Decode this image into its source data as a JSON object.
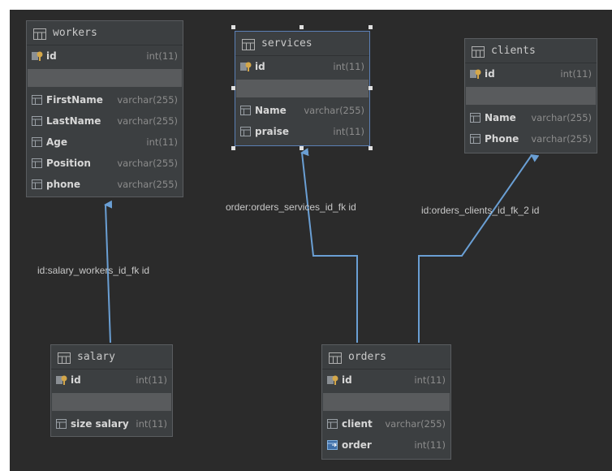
{
  "tables": {
    "workers": {
      "name": "workers",
      "pk": {
        "name": "id",
        "type": "int(11)"
      },
      "columns": [
        {
          "name": "FirstName",
          "type": "varchar(255)"
        },
        {
          "name": "LastName",
          "type": "varchar(255)"
        },
        {
          "name": "Age",
          "type": "int(11)"
        },
        {
          "name": "Position",
          "type": "varchar(255)"
        },
        {
          "name": "phone",
          "type": "varchar(255)"
        }
      ]
    },
    "services": {
      "name": "services",
      "pk": {
        "name": "id",
        "type": "int(11)"
      },
      "columns": [
        {
          "name": "Name",
          "type": "varchar(255)"
        },
        {
          "name": "praise",
          "type": "int(11)"
        }
      ]
    },
    "clients": {
      "name": "clients",
      "pk": {
        "name": "id",
        "type": "int(11)"
      },
      "columns": [
        {
          "name": "Name",
          "type": "varchar(255)"
        },
        {
          "name": "Phone",
          "type": "varchar(255)"
        }
      ]
    },
    "salary": {
      "name": "salary",
      "pk": {
        "name": "id",
        "type": "int(11)"
      },
      "columns": [
        {
          "name": "size salary",
          "type": "int(11)"
        }
      ]
    },
    "orders": {
      "name": "orders",
      "pk": {
        "name": "id",
        "type": "int(11)"
      },
      "columns": [
        {
          "name": "client",
          "type": "varchar(255)"
        },
        {
          "name": "order",
          "type": "int(11)"
        }
      ]
    }
  },
  "relations": {
    "salary_workers": "id:salary_workers_id_fk id",
    "orders_services": "order:orders_services_id_fk id",
    "orders_clients": "id:orders_clients_id_fk_2 id"
  },
  "colors": {
    "canvas": "#2b2b2b",
    "table_bg": "#3c3f41",
    "link": "#6a9fd4",
    "key_icon": "#d4a74a",
    "column_icon": "#9aa0a6"
  },
  "icons": {
    "table": "table-icon",
    "primary_key": "primary-key-icon",
    "column": "column-icon",
    "foreign_key": "foreign-key-icon"
  }
}
